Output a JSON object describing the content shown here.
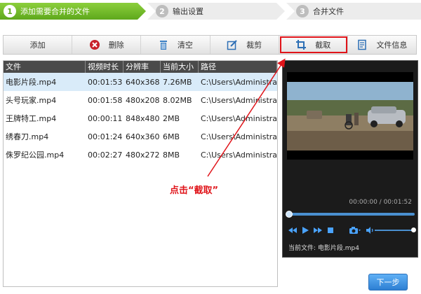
{
  "steps": [
    {
      "num": "1",
      "label": "添加需要合并的文件"
    },
    {
      "num": "2",
      "label": "输出设置"
    },
    {
      "num": "3",
      "label": "合并文件"
    }
  ],
  "toolbar": {
    "add": "添加",
    "delete": "删除",
    "clear": "清空",
    "crop": "裁剪",
    "clip": "截取",
    "info": "文件信息"
  },
  "table": {
    "headers": [
      "文件",
      "视频时长",
      "分辨率",
      "当前大小",
      "路径"
    ],
    "rows": [
      [
        "电影片段.mp4",
        "00:01:53",
        "640x368",
        "7.26MB",
        "C:\\Users\\Administra..."
      ],
      [
        "头号玩家.mp4",
        "00:01:58",
        "480x208",
        "8.02MB",
        "C:\\Users\\Administra..."
      ],
      [
        "王牌特工.mp4",
        "00:00:11",
        "848x480",
        "2MB",
        "C:\\Users\\Administra..."
      ],
      [
        "绣春刀.mp4",
        "00:01:24",
        "640x360",
        "6MB",
        "C:\\Users\\Administra..."
      ],
      [
        "侏罗纪公园.mp4",
        "00:02:27",
        "480x272",
        "8MB",
        "C:\\Users\\Administra..."
      ]
    ]
  },
  "player": {
    "time": "00:00:00 / 00:01:52",
    "current_file": "当前文件: 电影片段.mp4"
  },
  "annotation": "点击“截取”",
  "next_button": "下一步",
  "colors": {
    "accent_green": "#5ea81c",
    "highlight_red": "#e0141a",
    "button_blue": "#2d7fd3"
  }
}
